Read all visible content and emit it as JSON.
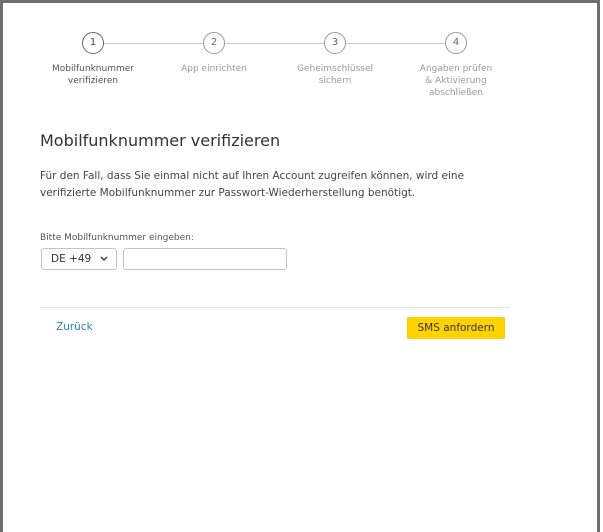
{
  "stepper": {
    "steps": [
      {
        "number": "1",
        "label_lines": [
          "Mobilfunknummer",
          "verifizieren"
        ]
      },
      {
        "number": "2",
        "label_lines": [
          "App einrichten"
        ]
      },
      {
        "number": "3",
        "label_lines": [
          "Geheimschlüssel",
          "sichern"
        ]
      },
      {
        "number": "4",
        "label_lines": [
          "Angaben prüfen",
          "& Aktivierung",
          "abschließen"
        ]
      }
    ]
  },
  "main": {
    "title": "Mobilfunknummer verifizieren",
    "description": "Für den Fall, dass Sie einmal nicht auf Ihren Account zugreifen können, wird eine verifizierte Mobilfunknummer zur Passwort-Wiederherstellung benötigt.",
    "phone_label": "Bitte Mobilfunknummer eingeben:",
    "country_code": "DE +49",
    "phone_value": "",
    "back_label": "Zurück",
    "submit_label": "SMS anfordern"
  },
  "colors": {
    "accent_button": "#ffd200",
    "link": "#2f7fb8"
  }
}
